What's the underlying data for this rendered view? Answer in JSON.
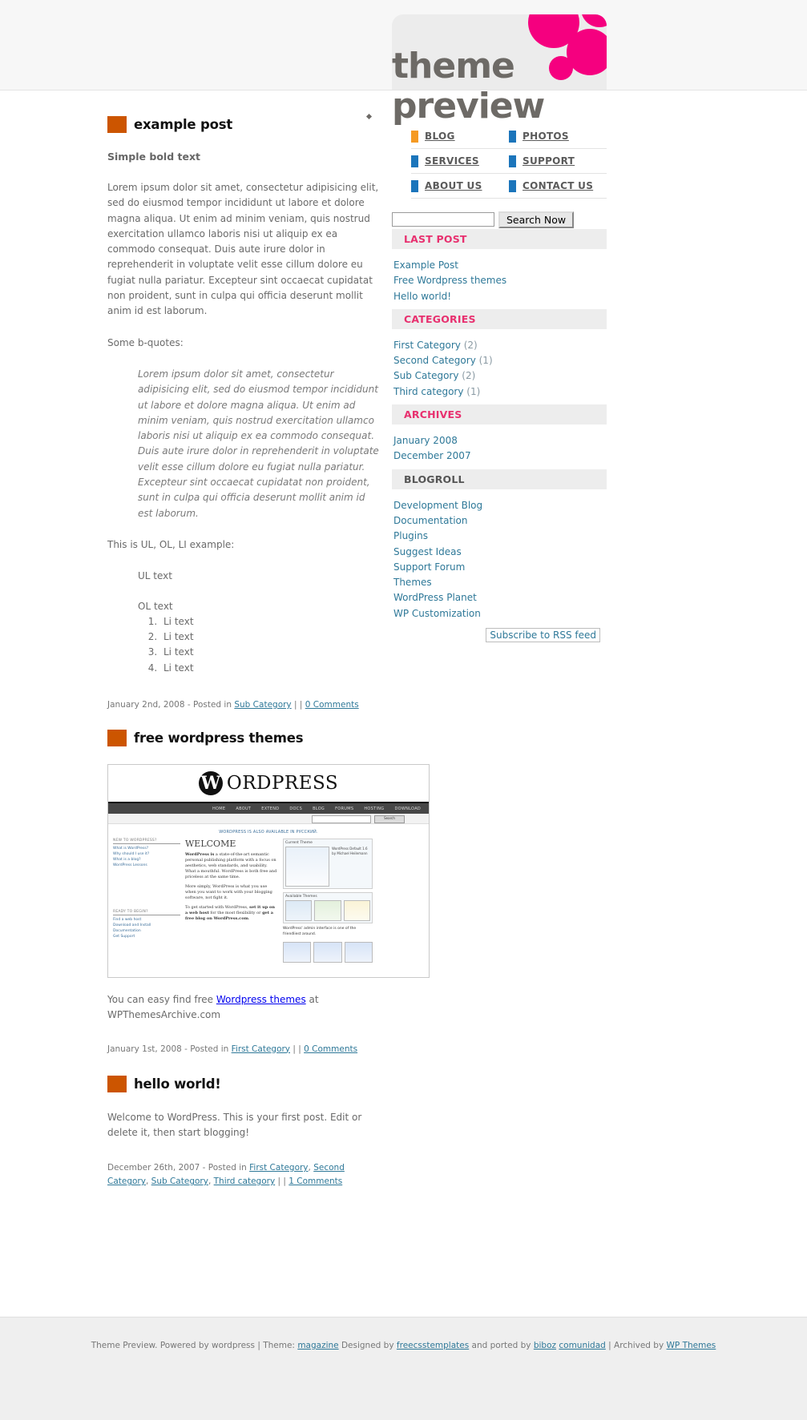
{
  "site": {
    "title_line1": "theme",
    "title_line2": "preview",
    "accent_pink": "#f5007f",
    "accent_orange": "#cc5500",
    "nav_bullet_orange": "#f59a23",
    "nav_bullet_blue": "#1b75bb",
    "widget_heading_color": "#e8306f",
    "link_color": "#2e7898"
  },
  "nav": {
    "items": [
      {
        "label": "BLOG",
        "bullet": "orange"
      },
      {
        "label": "PHOTOS",
        "bullet": "blue"
      },
      {
        "label": "SERVICES",
        "bullet": "blue"
      },
      {
        "label": "SUPPORT",
        "bullet": "blue"
      },
      {
        "label": "ABOUT US",
        "bullet": "blue"
      },
      {
        "label": "CONTACT US",
        "bullet": "blue"
      }
    ]
  },
  "search": {
    "value": "",
    "placeholder": "",
    "button_label": "Search Now"
  },
  "sidebar": {
    "widgets": [
      {
        "title": "LAST POST",
        "style": "pink",
        "items": [
          {
            "label": "Example Post"
          },
          {
            "label": "Free Wordpress themes"
          },
          {
            "label": "Hello world!"
          }
        ]
      },
      {
        "title": "CATEGORIES",
        "style": "pink",
        "items": [
          {
            "label": "First Category",
            "count": "(2)"
          },
          {
            "label": "Second Category",
            "count": "(1)"
          },
          {
            "label": "Sub Category",
            "count": "(2)"
          },
          {
            "label": "Third category",
            "count": "(1)"
          }
        ]
      },
      {
        "title": "ARCHIVES",
        "style": "pink",
        "items": [
          {
            "label": "January 2008"
          },
          {
            "label": "December 2007"
          }
        ]
      },
      {
        "title": "BLOGROLL",
        "style": "gray",
        "items": [
          {
            "label": "Development Blog"
          },
          {
            "label": "Documentation"
          },
          {
            "label": "Plugins"
          },
          {
            "label": "Suggest Ideas"
          },
          {
            "label": "Support Forum"
          },
          {
            "label": "Themes"
          },
          {
            "label": "WordPress Planet"
          },
          {
            "label": "WP Customization"
          }
        ]
      }
    ],
    "rss_label": "Subscribe to RSS feed"
  },
  "posts": {
    "post1": {
      "title": "example post",
      "bold_line": "Simple bold text",
      "para1": "Lorem ipsum dolor sit amet, consectetur adipisicing elit, sed do eiusmod tempor incididunt ut labore et dolore magna aliqua. Ut enim ad minim veniam, quis nostrud exercitation ullamco laboris nisi ut aliquip ex ea commodo consequat. Duis aute irure dolor in reprehenderit in voluptate velit esse cillum dolore eu fugiat nulla pariatur. Excepteur sint occaecat cupidatat non proident, sunt in culpa qui officia deserunt mollit anim id est laborum.",
      "para2": "Some b-quotes:",
      "quote": "Lorem ipsum dolor sit amet, consectetur adipisicing elit, sed do eiusmod tempor incididunt ut labore et dolore magna aliqua. Ut enim ad minim veniam, quis nostrud exercitation ullamco laboris nisi ut aliquip ex ea commodo consequat. Duis aute irure dolor in reprehenderit in voluptate velit esse cillum dolore eu fugiat nulla pariatur. Excepteur sint occaecat cupidatat non proident, sunt in culpa qui officia deserunt mollit anim id est laborum.",
      "list_intro": "This is UL, OL, LI example:",
      "ul_text": "UL text",
      "ol_text": "OL text",
      "li_items": [
        "Li text",
        "Li text",
        "Li text",
        "Li text"
      ],
      "meta_date": "January 2nd, 2008 - Posted in ",
      "meta_category": "Sub Category",
      "meta_sep": " |  | ",
      "meta_comments": "0 Comments"
    },
    "post2": {
      "title": "free wordpress themes",
      "body_before": "You can easy find free ",
      "body_link": "Wordpress themes",
      "body_after": " at WPThemesArchive.com",
      "meta_date": "January 1st, 2008 - Posted in ",
      "meta_category": "First Category",
      "meta_sep": " |  | ",
      "meta_comments": "0 Comments"
    },
    "post3": {
      "title": "hello world!",
      "para1": "Welcome to WordPress. This is your first post. Edit or delete it, then start blogging!",
      "meta_date": "December 26th, 2007 - Posted in ",
      "meta_cat1": "First Category",
      "meta_cat2": "Second Category",
      "meta_cat3": "Sub Category",
      "meta_cat4": "Third category",
      "meta_sep": " |  | ",
      "meta_comments": "1 Comments"
    }
  },
  "screenshot": {
    "wp_mark": "W",
    "wp_wordmark": "ORDPRESS",
    "menu": [
      "HOME",
      "ABOUT",
      "EXTEND",
      "DOCS",
      "BLOG",
      "FORUMS",
      "HOSTING",
      "DOWNLOAD"
    ],
    "search_button": "Search",
    "ru_line": "WORDPRESS IS ALSO AVAILABLE IN РУССКИЙ.",
    "col1_head1": "NEW TO WORDPRESS?",
    "col1_items1": [
      "What is WordPress?",
      "Why should I use it?",
      "What is a blog?",
      "WordPress Lessons"
    ],
    "col1_head2": "READY TO BEGIN?",
    "col1_items2": [
      "Find a web host",
      "Download and Install",
      "Documentation",
      "Get Support"
    ],
    "welcome": "WELCOME",
    "p1_bold": "WordPress is",
    "p1_rest": " a state-of-the-art semantic personal publishing platform with a focus on aesthetics, web standards, and usability. What a mouthful. WordPress is both free and priceless at the same time.",
    "p2": "More simply, WordPress is what you use when you want to work with your blogging software, not fight it.",
    "p3_a": "To get started with WordPress, ",
    "p3_b": "set it up on a web host",
    "p3_c": " for the most flexibility or ",
    "p3_d": "get a free blog on WordPress.com",
    "p3_e": ".",
    "panel1_title": "Current Theme",
    "panel1_sub": "WordPress Default 1.6 by Michael Heilemann",
    "panel2_title": "Available Themes",
    "panel_caption": "WordPress' admin interface is one of the friendliest around."
  },
  "footer": {
    "t1": "Theme Preview. Powered by wordpress | Theme: ",
    "l1": "magazine",
    "t2": " Designed by ",
    "l2": "freecsstemplates",
    "t3": " and ported by ",
    "l3": "biboz",
    "t4": " ",
    "l4": "comunidad",
    "t5": " | Archived by ",
    "l5": "WP Themes"
  }
}
